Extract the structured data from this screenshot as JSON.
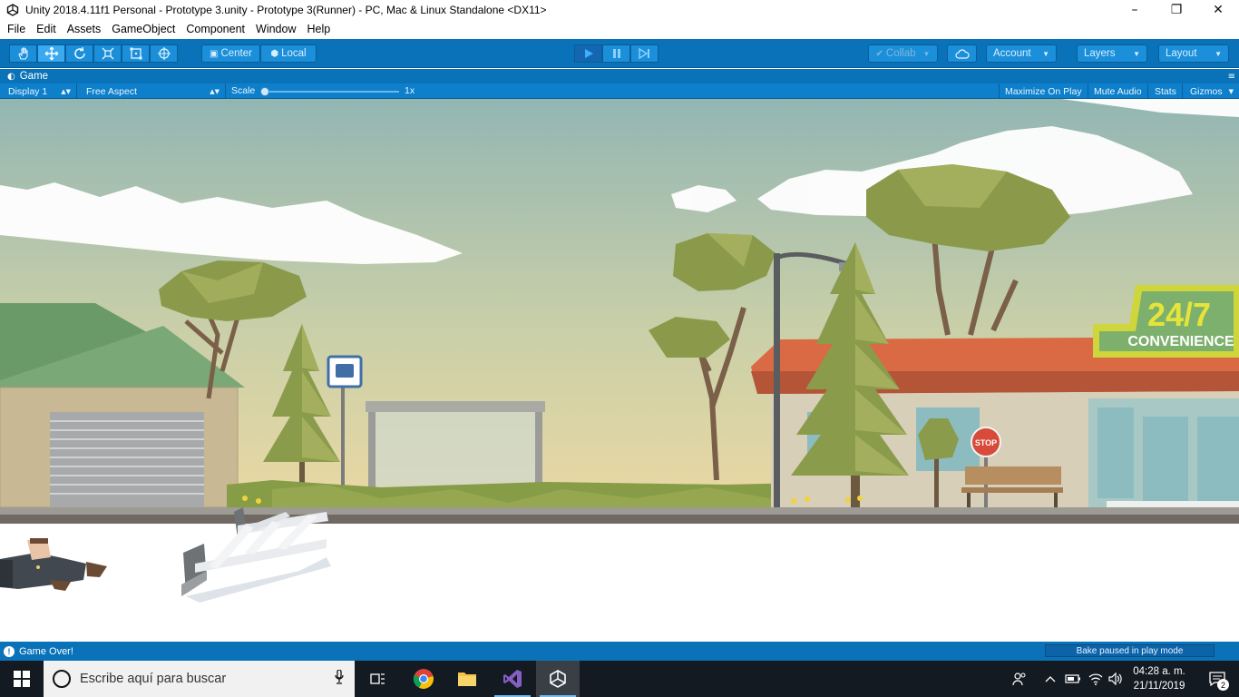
{
  "window": {
    "title": "Unity 2018.4.11f1 Personal - Prototype 3.unity - Prototype 3(Runner) - PC, Mac & Linux Standalone <DX11>",
    "minimize": "–",
    "maximize": "❐",
    "close": "✕"
  },
  "menu": [
    "File",
    "Edit",
    "Assets",
    "GameObject",
    "Component",
    "Window",
    "Help"
  ],
  "toolbar": {
    "tools": [
      "hand-tool",
      "move-tool",
      "rotate-tool",
      "scale-tool",
      "rect-tool",
      "transform-tool"
    ],
    "pivot_center": "Center",
    "pivot_local": "Local",
    "collab": "Collab",
    "account": "Account",
    "layers": "Layers",
    "layout": "Layout"
  },
  "game_tab": {
    "label": "Game",
    "display": "Display 1",
    "aspect": "Free Aspect",
    "scale_label": "Scale",
    "scale_value": "1x",
    "maximize_on_play": "Maximize On Play",
    "mute_audio": "Mute Audio",
    "stats": "Stats",
    "gizmos": "Gizmos"
  },
  "scene": {
    "store_sign_number": "24/7",
    "store_sign_text": "CONVENIENCE",
    "stop_sign": "STOP",
    "colors": {
      "sky_top": "#95b7b2",
      "sky_bottom": "#ead9a6",
      "road": "#ffffff",
      "foliage": "#8a9b4c",
      "roof": "#d96a44",
      "sign_yellow": "#cfd63c"
    }
  },
  "status": {
    "message": "Game Over!",
    "bake": "Bake paused in play mode"
  },
  "taskbar": {
    "search_placeholder": "Escribe aquí para buscar",
    "time": "04:28 a. m.",
    "date": "21/11/2019",
    "notification_count": "2"
  }
}
